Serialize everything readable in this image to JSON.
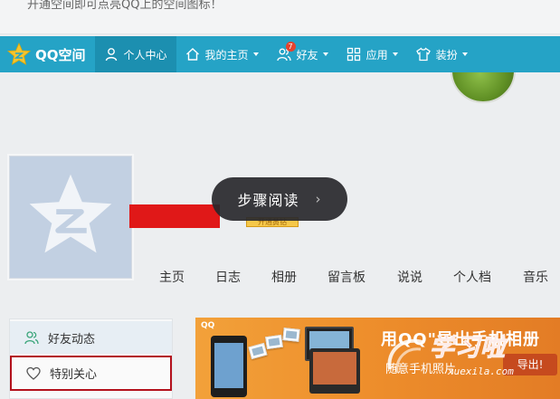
{
  "top_notice": "开通空间即可点亮QQ上的空间图标！",
  "navbar": {
    "brand": "QQ空间",
    "items": [
      {
        "label": "个人中心",
        "icon": "person-icon",
        "active": true
      },
      {
        "label": "我的主页",
        "icon": "home-icon",
        "dropdown": true
      },
      {
        "label": "好友",
        "icon": "friends-icon",
        "dropdown": true,
        "badge": "7"
      },
      {
        "label": "应用",
        "icon": "grid-icon",
        "dropdown": true
      },
      {
        "label": "装扮",
        "icon": "shirt-icon",
        "dropdown": true
      }
    ]
  },
  "profile": {
    "tag": "开通黄钻",
    "tooltip": "步骤阅读"
  },
  "tabs": [
    "主页",
    "日志",
    "相册",
    "留言板",
    "说说",
    "个人档",
    "音乐"
  ],
  "sidebar": {
    "items": [
      {
        "label": "好友动态",
        "icon": "friends-outline-icon"
      },
      {
        "label": "特别关心",
        "icon": "heart-icon"
      }
    ]
  },
  "banner": {
    "logo": "QQ",
    "headline": "用QQ\"导出手机相册",
    "sub": "随意手机照片",
    "button": "导出!"
  },
  "watermark": {
    "text": "学习啦",
    "url": "xuexila.com"
  },
  "colors": {
    "nav_bg": "#25a3c6",
    "nav_active": "#1c8fb0",
    "highlight_border": "#b3111c",
    "redaction": "#e01818"
  }
}
